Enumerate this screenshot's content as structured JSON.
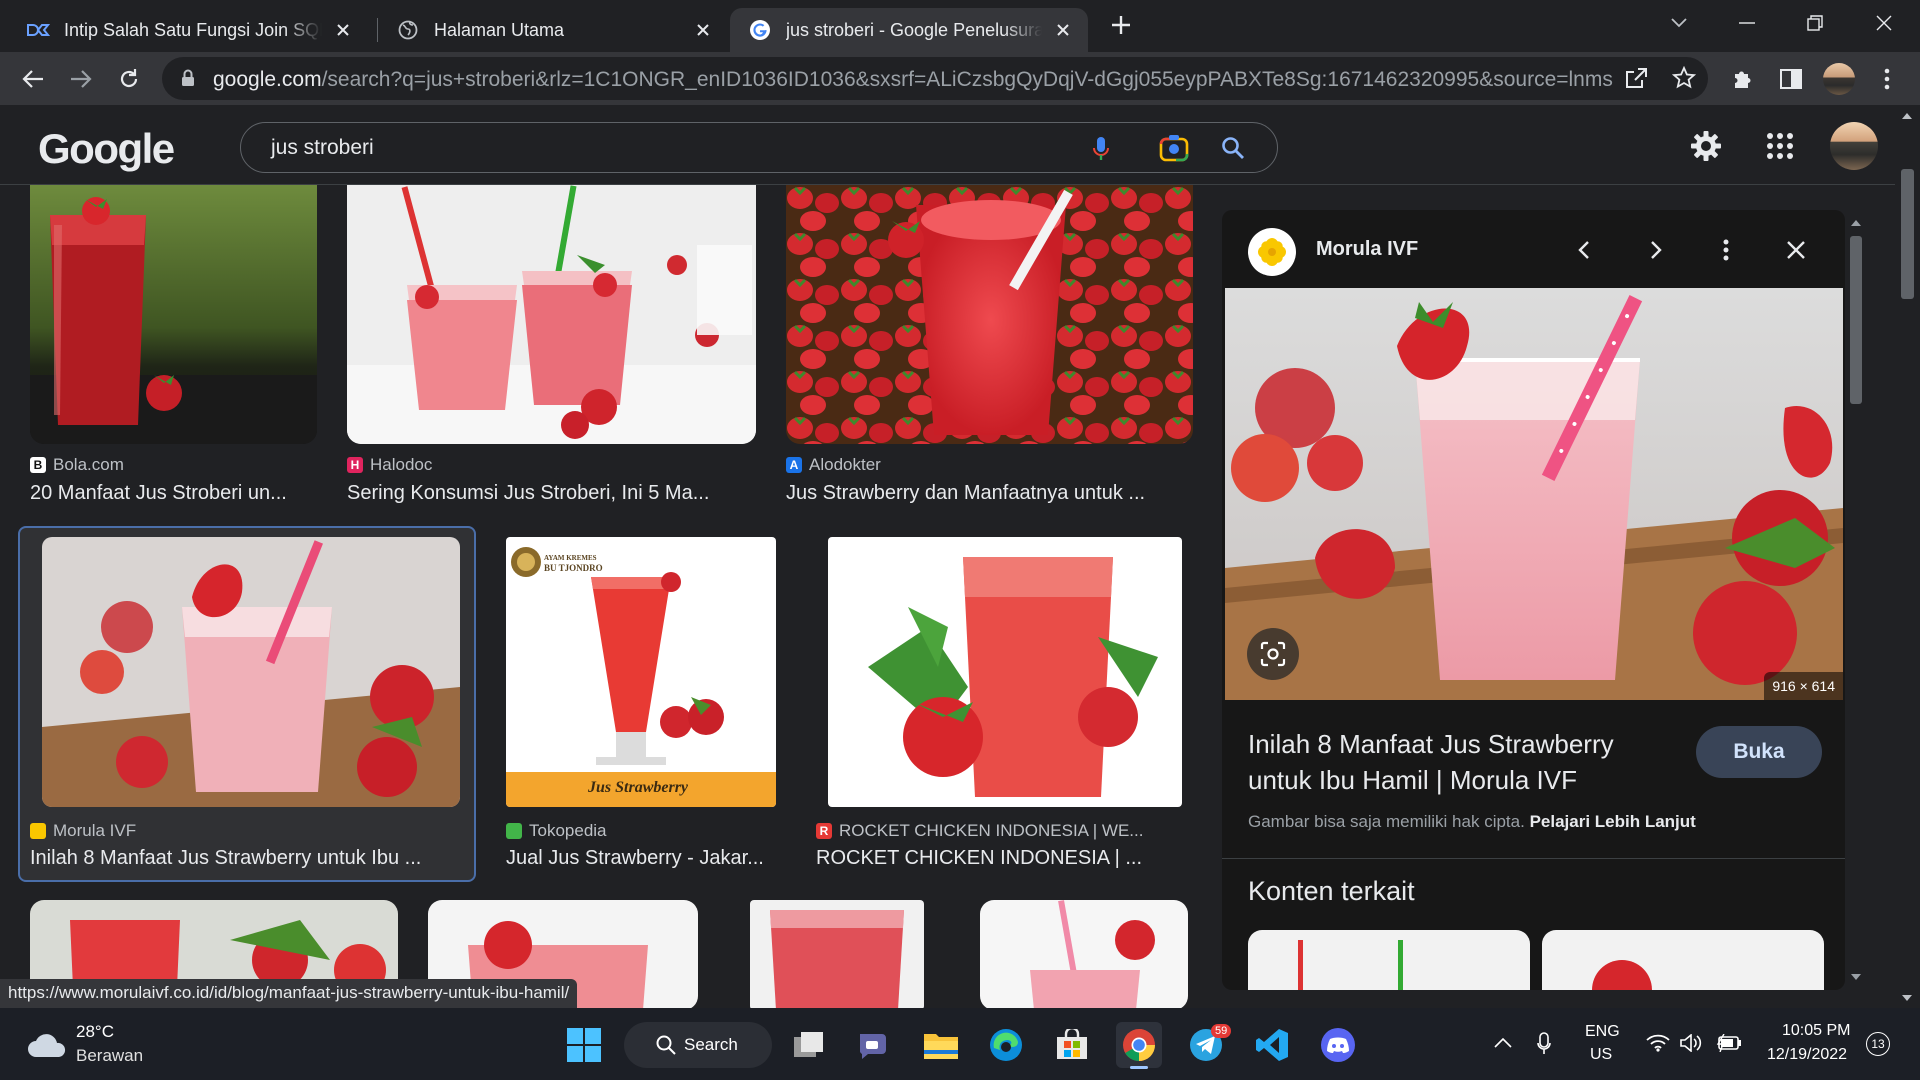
{
  "browser": {
    "tabs": [
      {
        "title": "Intip Salah Satu Fungsi Join SQL,",
        "icon": "dicoding-icon",
        "active": false
      },
      {
        "title": "Halaman Utama",
        "icon": "globe-icon",
        "active": false
      },
      {
        "title": "jus stroberi - Google Penelusuran",
        "icon": "google-icon",
        "active": true
      }
    ],
    "url_domain": "google.com",
    "url_path": "/search?q=jus+stroberi&rlz=1C1ONGR_enID1036ID1036&sxsrf=ALiCzsbgQyDqjV-dGgj055eypPABXTe8Sg:1671462320995&source=lnms..."
  },
  "google": {
    "logo": "Google",
    "query": "jus stroberi"
  },
  "results": [
    {
      "source": "Bola.com",
      "title": "20 Manfaat Jus Stroberi un...",
      "source_color": "#ffffff"
    },
    {
      "source": "Halodoc",
      "title": "Sering Konsumsi Jus Stroberi, Ini 5 Ma...",
      "source_color": "#e0245e"
    },
    {
      "source": "Alodokter",
      "title": "Jus Strawberry dan Manfaatnya untuk ...",
      "source_color": "#1a73e8"
    },
    {
      "source": "Morula IVF",
      "title": "Inilah 8 Manfaat Jus Strawberry untuk Ibu ...",
      "source_color": "#f9c700",
      "selected": true
    },
    {
      "source": "Tokopedia",
      "title": "Jual Jus Strawberry - Jakar...",
      "source_color": "#42b549",
      "image_text_1": "AYAM KREMES",
      "image_text_2": "BU TJONDRO",
      "image_text_3": "Jus Strawberry"
    },
    {
      "source": "ROCKET CHICKEN INDONESIA | WE...",
      "title": "ROCKET CHICKEN INDONESIA | ...",
      "source_color": "#e53935"
    }
  ],
  "panel": {
    "site": "Morula IVF",
    "dimensions": "916 × 614",
    "title": "Inilah 8 Manfaat Jus Strawberry untuk Ibu Hamil | Morula IVF",
    "open_button": "Buka",
    "copyright_text": "Gambar bisa saja memiliki hak cipta.",
    "learn_more": "Pelajari Lebih Lanjut",
    "related_heading": "Konten terkait"
  },
  "status_url": "https://www.morulaivf.co.id/id/blog/manfaat-jus-strawberry-untuk-ibu-hamil/",
  "taskbar": {
    "weather_temp": "28°C",
    "weather_desc": "Berawan",
    "search_label": "Search",
    "telegram_badge": "59",
    "lang_1": "ENG",
    "lang_2": "US",
    "time": "10:05 PM",
    "date": "12/19/2022",
    "notification_count": "13"
  },
  "colors": {
    "accent_blue": "#8ab4f8",
    "selected_border": "#4a6ea9",
    "strawberry_red": "#d7262b",
    "juice_pink": "#f2a9b3"
  }
}
